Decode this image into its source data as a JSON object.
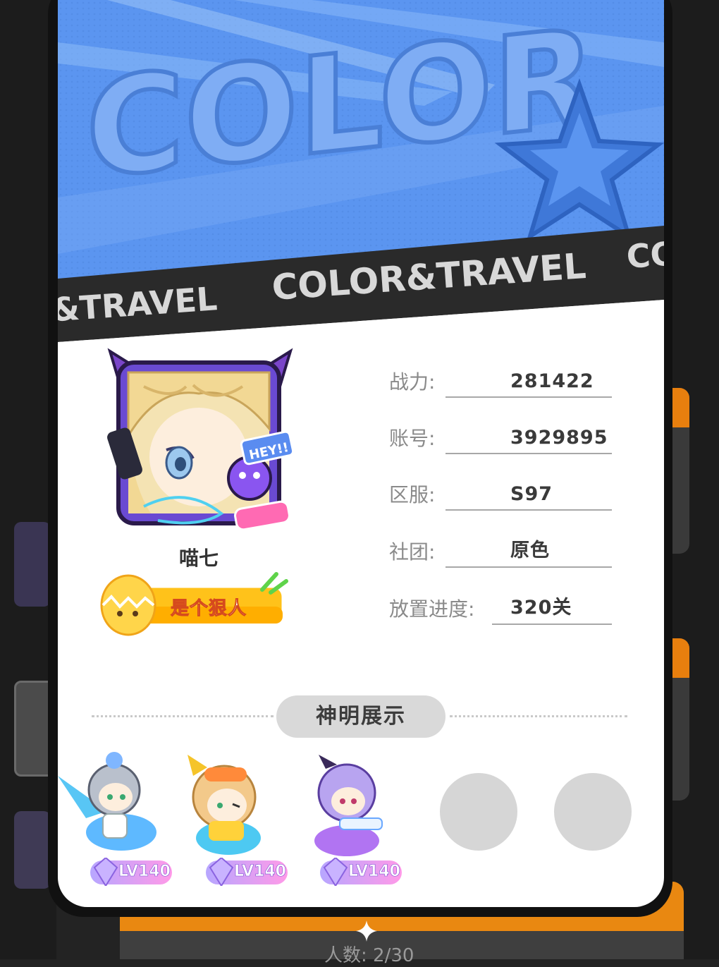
{
  "banner": {
    "big_text": "COLOR",
    "strip_text_left": "&TRAVEL",
    "strip_text_main": "COLOR&TRAVEL",
    "strip_text_right": "CO"
  },
  "profile": {
    "nickname": "喵七",
    "avatar_tag": "HEY!!",
    "title_badge": "是个狠人"
  },
  "info": {
    "power_label": "战力:",
    "power_value": "281422",
    "account_label": "账号:",
    "account_value": "3929895",
    "server_label": "区服:",
    "server_value": "S97",
    "club_label": "社团:",
    "club_value": "原色",
    "progress_label": "放置进度:",
    "progress_value": "320关"
  },
  "section": {
    "title": "神明展示"
  },
  "gods": [
    {
      "level": "LV140"
    },
    {
      "level": "LV140"
    },
    {
      "level": "LV140"
    }
  ],
  "background": {
    "bottom_text": "人数: 2/30"
  },
  "colors": {
    "banner_blue": "#5b95f0",
    "strip_dark": "#2a2a2a",
    "accent_orange": "#e98811",
    "badge_yellow": "#ffc21a"
  }
}
